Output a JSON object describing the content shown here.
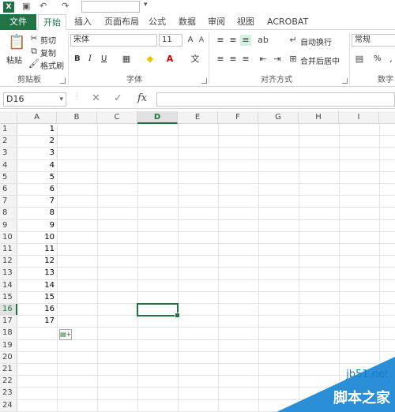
{
  "qat": {
    "app_icon": "X",
    "redo_text": "↷",
    "undo_text": "↶"
  },
  "tabs": [
    "文件",
    "开始",
    "插入",
    "页面布局",
    "公式",
    "数据",
    "审阅",
    "视图",
    "ACROBAT"
  ],
  "ribbon": {
    "clipboard": {
      "label": "剪贴板",
      "paste": "粘贴",
      "cut": "剪切",
      "copy": "复制",
      "format_painter": "格式刷"
    },
    "font": {
      "label": "字体",
      "font_name": "宋体",
      "font_size": "11",
      "bold": "B",
      "italic": "I",
      "underline": "U"
    },
    "alignment": {
      "label": "对齐方式",
      "wrap_text": "自动换行",
      "merge_center": "合并后居中"
    },
    "number": {
      "label": "数字",
      "format": "常规",
      "percent": "%"
    }
  },
  "formula_bar": {
    "name_box": "D16",
    "fx": "fx"
  },
  "columns": [
    "A",
    "B",
    "C",
    "D",
    "E",
    "F",
    "G",
    "H",
    "I"
  ],
  "selected_column": "D",
  "selected_row": 16,
  "rows": [
    {
      "n": "1",
      "a": "1"
    },
    {
      "n": "2",
      "a": "2"
    },
    {
      "n": "3",
      "a": "3"
    },
    {
      "n": "4",
      "a": "4"
    },
    {
      "n": "5",
      "a": "5"
    },
    {
      "n": "6",
      "a": "6"
    },
    {
      "n": "7",
      "a": "7"
    },
    {
      "n": "8",
      "a": "8"
    },
    {
      "n": "9",
      "a": "9"
    },
    {
      "n": "10",
      "a": "10"
    },
    {
      "n": "11",
      "a": "11"
    },
    {
      "n": "12",
      "a": "12"
    },
    {
      "n": "13",
      "a": "13"
    },
    {
      "n": "14",
      "a": "14"
    },
    {
      "n": "15",
      "a": "15"
    },
    {
      "n": "16",
      "a": "16"
    },
    {
      "n": "17",
      "a": "17"
    },
    {
      "n": "18",
      "a": ""
    },
    {
      "n": "19",
      "a": ""
    },
    {
      "n": "20",
      "a": ""
    },
    {
      "n": "21",
      "a": ""
    },
    {
      "n": "22",
      "a": ""
    },
    {
      "n": "23",
      "a": ""
    },
    {
      "n": "24",
      "a": ""
    }
  ],
  "watermark": {
    "url": "jb51.net",
    "text": "脚本之家"
  },
  "colors": {
    "accent": "#217346",
    "watermark": "#2a8fd6"
  }
}
